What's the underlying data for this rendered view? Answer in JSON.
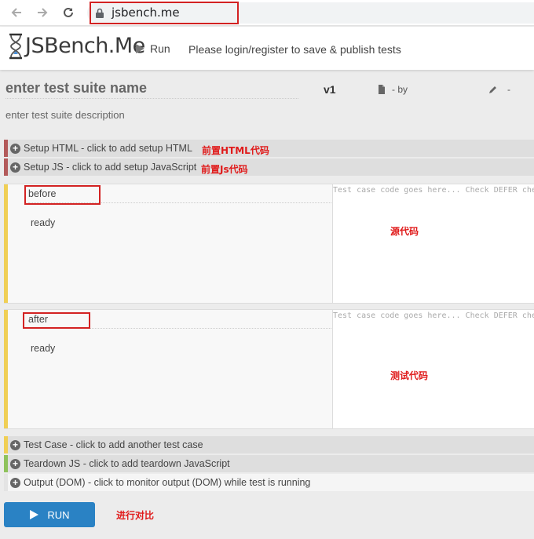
{
  "browser": {
    "url": "jsbench.me"
  },
  "app": {
    "logo_text": "JSBench.Me",
    "run_label": "Run",
    "login_message": "Please login/register to save & publish tests"
  },
  "suite": {
    "name_placeholder": "enter test suite name",
    "version": "v1",
    "by_text": "- by",
    "edit_text": "-",
    "description_placeholder": "enter test suite description"
  },
  "sections": {
    "setup_html": "Setup HTML - click to add setup HTML",
    "setup_js": "Setup JS - click to add setup JavaScript",
    "test_case": "Test Case - click to add another test case",
    "teardown_js": "Teardown JS - click to add teardown JavaScript",
    "output_dom": "Output (DOM) - click to monitor output (DOM) while test is running"
  },
  "test_cases": [
    {
      "title": "before",
      "status": "ready",
      "code_placeholder": "Test case code goes here... Check DEFER checkbox if benchmarking async code."
    },
    {
      "title": "after",
      "status": "ready",
      "code_placeholder": "Test case code goes here... Check DEFER checkbox if benchmarking async code."
    }
  ],
  "run_button": {
    "label": "RUN"
  },
  "annotations": {
    "setup_html": "前置HTML代码",
    "setup_js": "前置Js代码",
    "source_code": "源代码",
    "test_code": "测试代码",
    "compare": "进行对比"
  },
  "colors": {
    "accent_blue": "#2a82c4",
    "setup_bar": "#b35a5a",
    "case_bar": "#f0cf55",
    "teardown_bar": "#8fc25c",
    "annotation_red": "#e01b1b"
  }
}
